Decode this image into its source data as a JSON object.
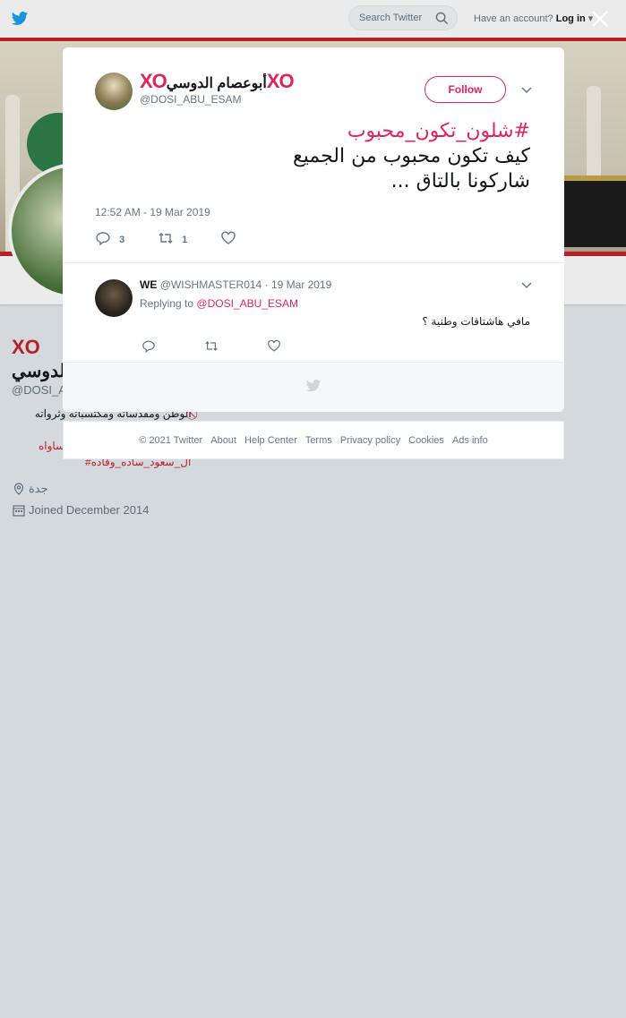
{
  "header": {
    "search_placeholder": "Search Twitter",
    "have_account": "Have an account?",
    "login": "Log in"
  },
  "profile": {
    "xo": "XO",
    "name_part2": "الدوسي",
    "handle": "@DOSI_A",
    "bio": "الوطن ومقدساته ومكتسباته وثرواته",
    "tag1": "ساواه",
    "tag2": "#ال_سعود_ساده_وقاده",
    "location": "جدة",
    "joined": "Joined December 2014"
  },
  "tweet": {
    "xo_left": "XO",
    "display_name": "أبوعصام الدوسي",
    "xo_right": "XO",
    "handle": "@DOSI_ABU_ESAM",
    "follow_label": "Follow",
    "hashtag": "#شلون_تكون_محبوب",
    "line1": "كيف تكون محبوب من الجميع",
    "line2": "شاركونا بالتاق ...",
    "timestamp": "12:52 AM - 19 Mar 2019",
    "reply_count": "3",
    "retweet_count": "1",
    "like_count": ""
  },
  "reply": {
    "name": "WE",
    "handle": "@WISHMASTER014",
    "date": "· 19 Mar 2019",
    "replying_to_label": "Replying to",
    "replying_to_handle": "@DOSI_ABU_ESAM",
    "text": "مافي هاشتاقات وطنية ؟"
  },
  "footer": {
    "links": [
      "© 2021 Twitter",
      "About",
      "Help Center",
      "Terms",
      "Privacy policy",
      "Cookies",
      "Ads info"
    ]
  },
  "colors": {
    "accent": "#e0245e",
    "brand": "#1da1f2",
    "cover_border": "#c8232c"
  }
}
